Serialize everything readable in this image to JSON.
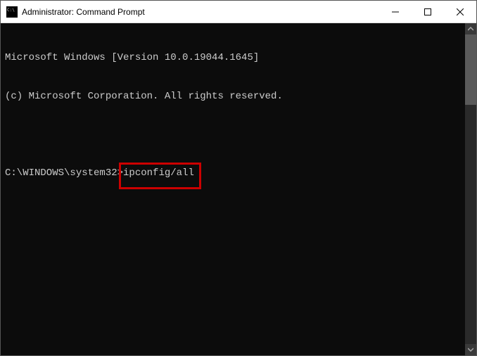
{
  "titlebar": {
    "title": "Administrator: Command Prompt"
  },
  "terminal": {
    "line1": "Microsoft Windows [Version 10.0.19044.1645]",
    "line2": "(c) Microsoft Corporation. All rights reserved.",
    "prompt": "C:\\WINDOWS\\system32>",
    "command": "ipconfig/all"
  },
  "highlight": {
    "present": true,
    "target": "command"
  },
  "colors": {
    "terminal_bg": "#0c0c0c",
    "terminal_fg": "#cccccc",
    "highlight_border": "#cc0000"
  }
}
